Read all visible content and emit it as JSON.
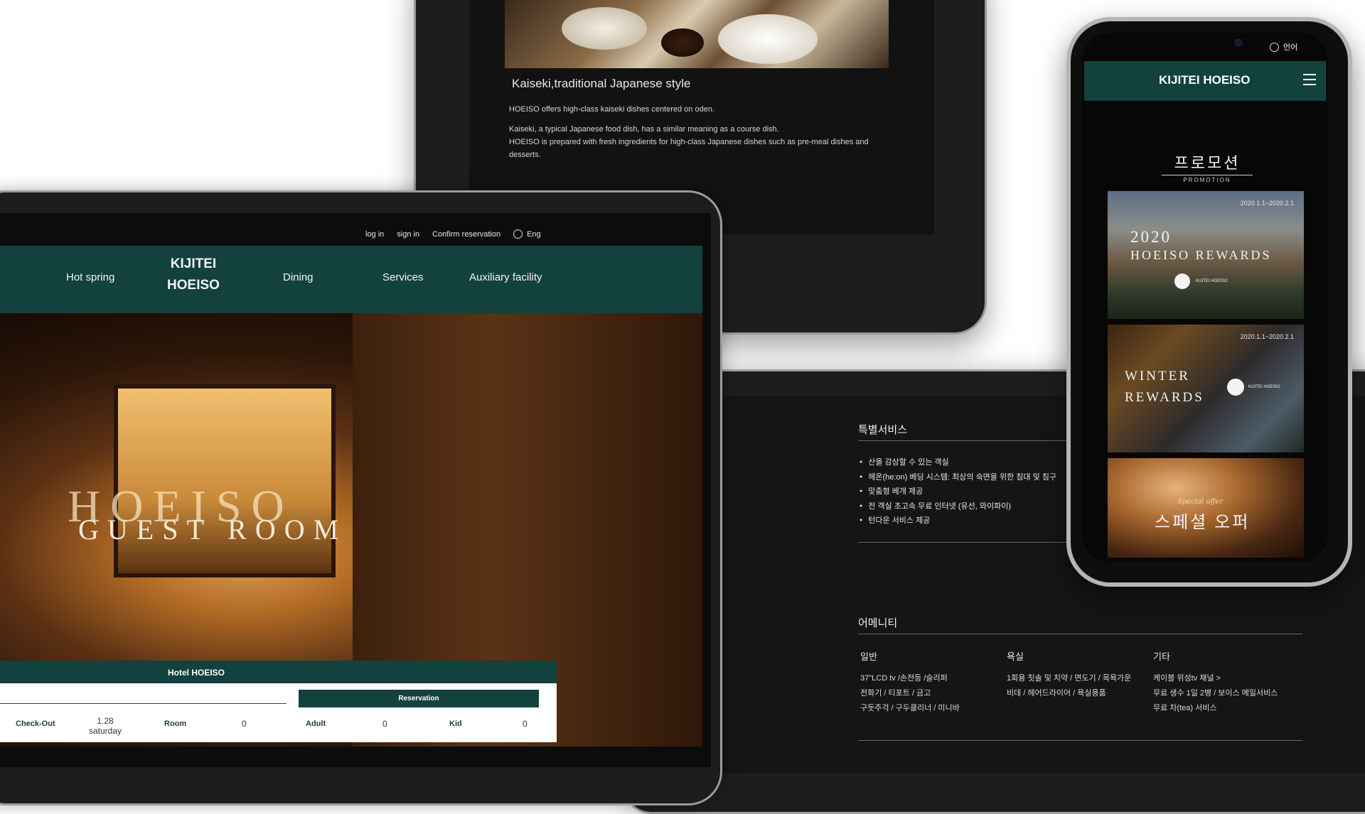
{
  "top_tablet": {
    "title": "Kaiseki,traditional Japanese style",
    "paragraph1": "HOEISO offers high-class kaiseki dishes centered on oden.",
    "paragraph2a": "Kaiseki, a typical Japanese food dish, has a similar meaning as a course dish.",
    "paragraph2b": "HOEISO is prepared with fresh ingredients for high-class Japanese dishes such as pre-meal dishes and desserts."
  },
  "laptop": {
    "topbar": {
      "login": "log in",
      "signin": "sign in",
      "confirm": "Confirm reservation",
      "lang": "Eng"
    },
    "nav": {
      "hot_spring": "Hot spring",
      "brand_line1": "KIJITEI",
      "brand_line2": "HOEISO",
      "dining": "Dining",
      "services": "Services",
      "auxiliary": "Auxiliary facility"
    },
    "hero": {
      "main": "HOEISO",
      "sub": "GUEST ROOM"
    },
    "booking": {
      "header": "Hotel HOEISO",
      "reservation_button": "Reservation",
      "checkout_label": "Check-Out",
      "checkout_date": "1.28",
      "checkout_day": "saturday",
      "room_label": "Room",
      "room_value": "0",
      "adult_label": "Adult",
      "adult_value": "0",
      "kid_label": "Kid",
      "kid_value": "0"
    }
  },
  "right_tablet": {
    "special_services": {
      "title": "특별서비스",
      "items": [
        "산을 감상할 수 있는 객실",
        "헤온(he:on) 베딩 시스템: 최상의 숙면을 위한 침대 및 침구",
        "맞춤형 베개 제공",
        "전 객실 초고속 무료 인터넷 (유선, 와이파이)",
        "턴다운 서비스 제공"
      ]
    },
    "amenities": {
      "title": "어메니티",
      "columns": [
        {
          "heading": "일반",
          "lines": [
            "37\"LCD tv /손전등 /슬리퍼",
            "전화기 / 티포트 / 금고",
            "구둣주걱 / 구두클리너 / 미니바"
          ]
        },
        {
          "heading": "욕실",
          "lines": [
            "1회용 칫솔 및 치약 / 면도기 / 목욕가운",
            "비데 / 헤어드라이어 / 욕실용품"
          ]
        },
        {
          "heading": "기타",
          "lines": [
            "케이블 위성tv 채널 >",
            "무료 생수 1일 2병 / 보이스 메일서비스",
            "무료 차(tea) 서비스"
          ]
        }
      ]
    }
  },
  "phone": {
    "lang": "언어",
    "brand": "KIJITEI HOEISO",
    "promo_title": "프로모션",
    "promo_sub": "PROMOTION",
    "cards": [
      {
        "date": "2020.1.1~2020.2.1",
        "title1": "2020",
        "title2": "HOEISO REWARDS",
        "logo": "KIJITEI HOEISO"
      },
      {
        "date": "2020.1.1~2020.2.1",
        "title1": "WINTER",
        "title2": "REWARDS",
        "logo": "KIJITEI HOEISO"
      },
      {
        "small": "Special offer",
        "title1": "스페셜 오퍼"
      }
    ]
  }
}
